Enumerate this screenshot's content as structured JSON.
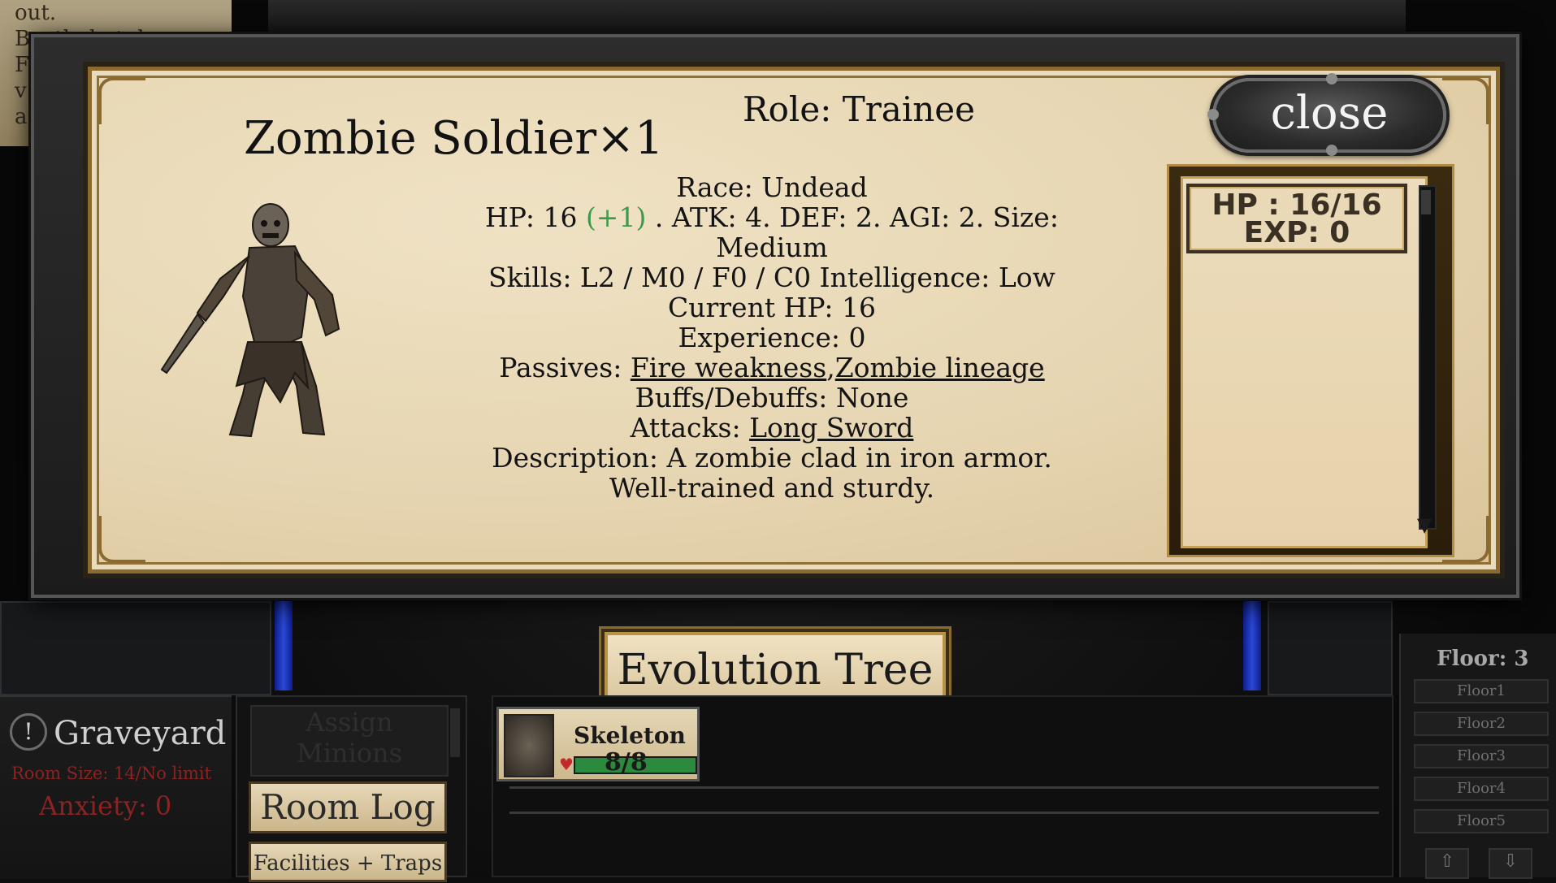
{
  "background": {
    "note_lines": [
      "out.",
      "Bustlo lo t d",
      "F",
      "v",
      "a"
    ]
  },
  "unit": {
    "title": "Zombie Soldier×1",
    "role": "Role: Trainee",
    "race": "Race: Undead",
    "hp_label": "HP: 16",
    "hp_bonus": "(+1)",
    "stats_line": ". ATK: 4. DEF: 2. AGI: 2. Size:",
    "size_value": "Medium",
    "skills": "Skills: L2 / M0 / F0 / C0 Intelligence: Low",
    "current_hp": "Current HP: 16",
    "experience": "Experience: 0",
    "passives_label": "Passives: ",
    "passive_1": "Fire weakness",
    "passive_sep": ",",
    "passive_2": "Zombie lineage",
    "buffs": "Buffs/Debuffs: None",
    "attacks_label": "Attacks: ",
    "attack_1": "Long Sword",
    "description_1": "Description: A zombie clad in iron armor.",
    "description_2": "Well-trained and sturdy."
  },
  "status_panel": {
    "hp": "HP : 16/16",
    "exp": "EXP: 0"
  },
  "buttons": {
    "close": "close",
    "evolution_tree": "Evolution Tree",
    "assign_minions": "Assign Minions",
    "room_log": "Room Log",
    "facilities_traps": "Facilities + Traps"
  },
  "room": {
    "name": "Graveyard",
    "size": "Room Size: 14/No limit",
    "anxiety": "Anxiety: 0",
    "icon": "!"
  },
  "minion": {
    "name": "Skeleton",
    "hp": "8/8",
    "hp_fraction": 1.0
  },
  "floors": {
    "title": "Floor: 3",
    "items": [
      "Floor1",
      "Floor2",
      "Floor3",
      "Floor4",
      "Floor5"
    ],
    "up": "⇧",
    "down": "⇩"
  },
  "colors": {
    "hp_bonus": "#3c9a4a",
    "danger_text": "#8b2323",
    "parchment": "#e6d5b1",
    "gold_frame": "#8a6a2e"
  }
}
